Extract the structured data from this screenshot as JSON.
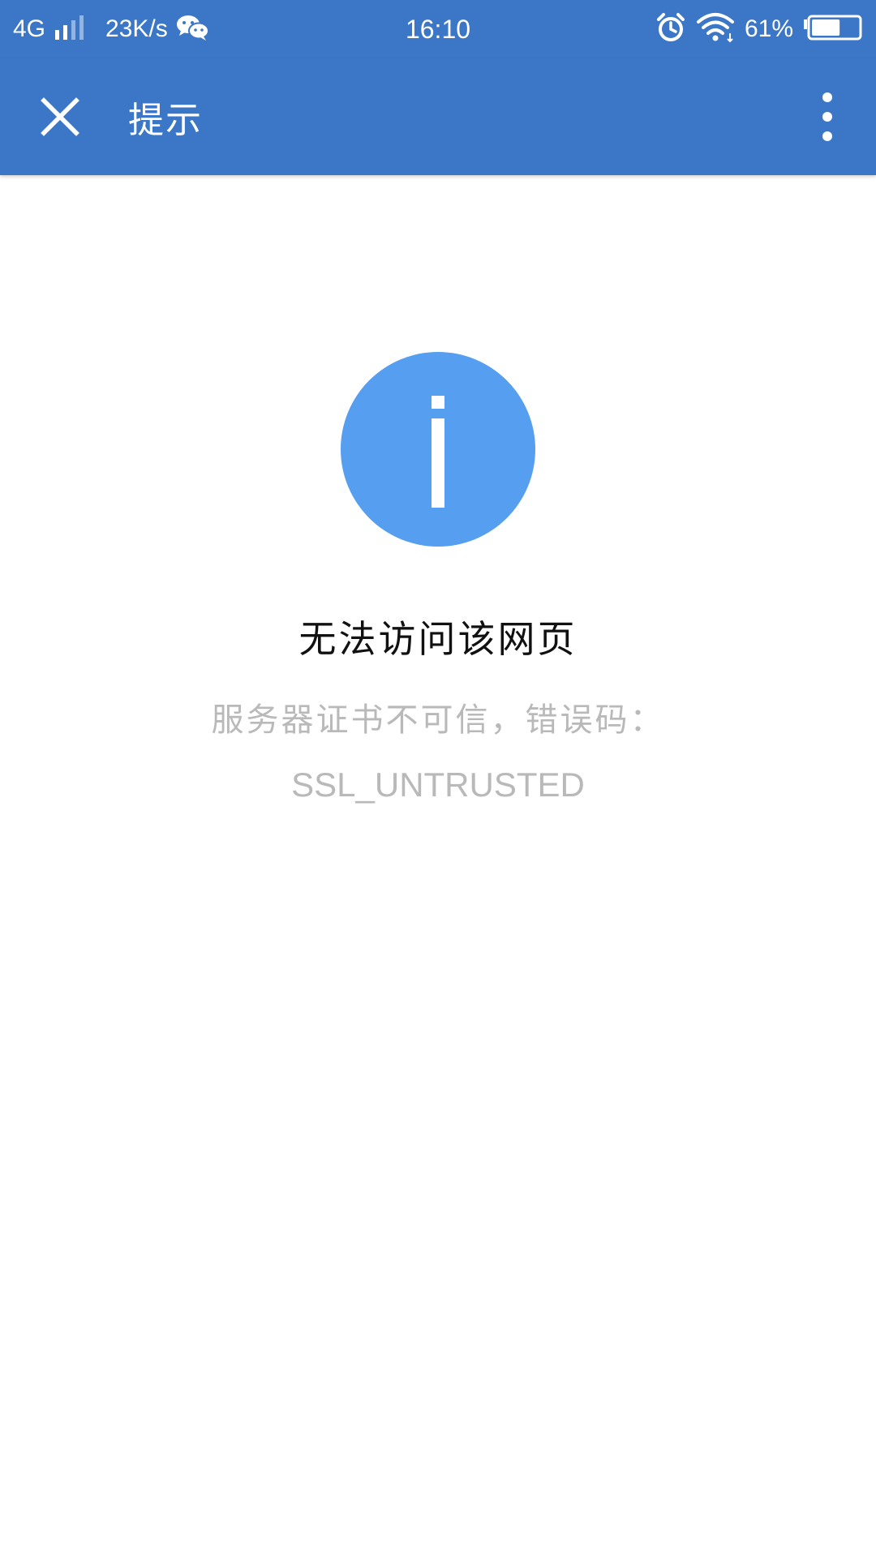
{
  "status_bar": {
    "network": "4G",
    "speed": "23K/s",
    "time": "16:10",
    "battery": "61%",
    "battery_level": 0.61,
    "icons": [
      "signal-icon",
      "wechat-icon",
      "alarm-icon",
      "wifi-icon",
      "battery-icon"
    ]
  },
  "app_bar": {
    "title": "提示",
    "close_icon": "close-icon",
    "more_icon": "more-vertical-icon"
  },
  "content": {
    "icon": "info-icon",
    "title": "无法访问该网页",
    "message": "服务器证书不可信，错误码：",
    "error_code": "SSL_UNTRUSTED"
  },
  "colors": {
    "bar": "#3b77c6",
    "icon_circle": "#569eef",
    "title_text": "#111111",
    "muted_text": "#b9b9b9"
  }
}
